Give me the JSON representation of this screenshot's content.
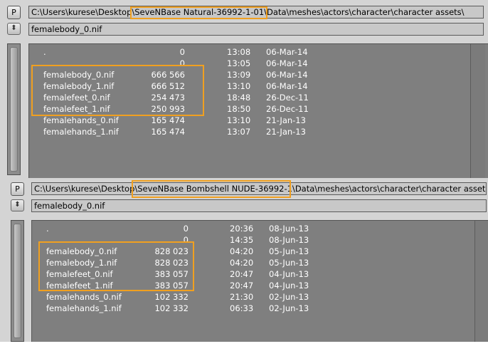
{
  "panel1": {
    "path_prefix": "C:\\Users\\kurese\\Desktop\\",
    "path_highlight": "SeveNBase Natural-36992-1-01\\",
    "path_suffix": "Data\\meshes\\actors\\character\\character assets\\",
    "filename": "femalebody_0.nif",
    "p_label": "P",
    "arrow_glyph": "⬍",
    "rows": [
      {
        "name": ".",
        "size": "0",
        "time": "13:08",
        "date": "06-Mar-14"
      },
      {
        "name": "",
        "size": "0",
        "time": "13:05",
        "date": "06-Mar-14"
      },
      {
        "name": "femalebody_0.nif",
        "size": "666 566",
        "time": "13:09",
        "date": "06-Mar-14"
      },
      {
        "name": "femalebody_1.nif",
        "size": "666 512",
        "time": "13:10",
        "date": "06-Mar-14"
      },
      {
        "name": "femalefeet_0.nif",
        "size": "254 473",
        "time": "18:48",
        "date": "26-Dec-11"
      },
      {
        "name": "femalefeet_1.nif",
        "size": "250 993",
        "time": "18:50",
        "date": "26-Dec-11"
      },
      {
        "name": "femalehands_0.nif",
        "size": "165 474",
        "time": "13:10",
        "date": "21-Jan-13"
      },
      {
        "name": "femalehands_1.nif",
        "size": "165 474",
        "time": "13:07",
        "date": "21-Jan-13"
      }
    ]
  },
  "panel2": {
    "path_prefix": "C:\\Users\\kurese\\Desktop\\",
    "path_highlight": "SeveNBase Bombshell NUDE-36992-1\\",
    "path_suffix": "Data\\meshes\\actors\\character\\character assets\\",
    "filename": "femalebody_0.nif",
    "p_label": "P",
    "arrow_glyph": "⬍",
    "rows": [
      {
        "name": ".",
        "size": "0",
        "time": "20:36",
        "date": "08-Jun-13"
      },
      {
        "name": "",
        "size": "0",
        "time": "14:35",
        "date": "08-Jun-13"
      },
      {
        "name": "femalebody_0.nif",
        "size": "828 023",
        "time": "04:20",
        "date": "05-Jun-13"
      },
      {
        "name": "femalebody_1.nif",
        "size": "828 023",
        "time": "04:20",
        "date": "05-Jun-13"
      },
      {
        "name": "femalefeet_0.nif",
        "size": "383 057",
        "time": "20:47",
        "date": "04-Jun-13"
      },
      {
        "name": "femalefeet_1.nif",
        "size": "383 057",
        "time": "20:47",
        "date": "04-Jun-13"
      },
      {
        "name": "femalehands_0.nif",
        "size": "102 332",
        "time": "21:30",
        "date": "02-Jun-13"
      },
      {
        "name": "femalehands_1.nif",
        "size": "102 332",
        "time": "06:33",
        "date": "02-Jun-13"
      }
    ]
  },
  "colors": {
    "highlight": "#f0a020",
    "list_bg": "#7f7f7f",
    "panel_bg": "#d4d4d4",
    "row_text": "#ffffff"
  }
}
